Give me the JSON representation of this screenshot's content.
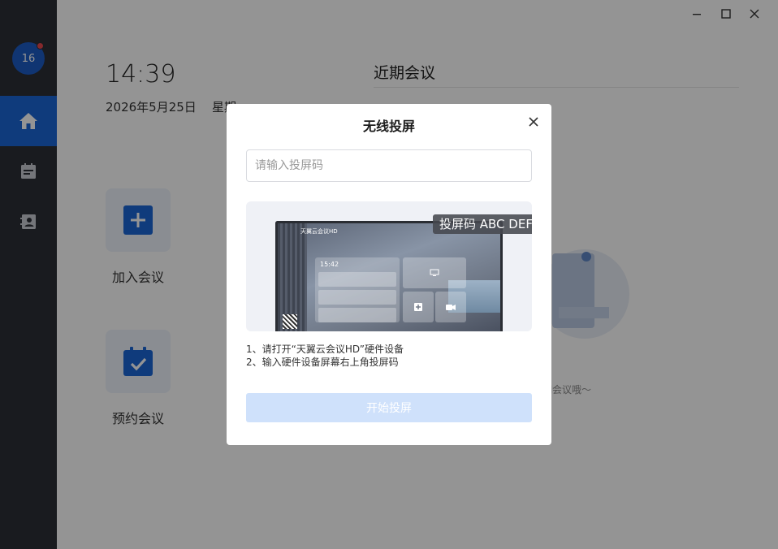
{
  "colors": {
    "sidebar_bg": "#2c2f36",
    "accent": "#1a66d6",
    "badge_dot": "#e5484d",
    "start_button_disabled": "#cfe1fb"
  },
  "sidebar": {
    "avatar_text": "16",
    "items": [
      {
        "name": "home",
        "icon": "home-icon",
        "active": true
      },
      {
        "name": "schedule",
        "icon": "calendar-icon",
        "active": false
      },
      {
        "name": "contacts",
        "icon": "contacts-icon",
        "active": false
      }
    ]
  },
  "window_controls": {
    "minimize": "minimize-icon",
    "maximize": "maximize-icon",
    "close": "close-icon"
  },
  "home": {
    "time": "14:39",
    "date": "2026年5月25日",
    "weekday": "星期",
    "recent_title": "近期会议",
    "join_label": "加入会议",
    "book_label": "预约会议",
    "empty_text": "期会议哦～"
  },
  "dialog": {
    "title": "无线投屏",
    "input_placeholder": "请输入投屏码",
    "input_value": "",
    "code_badge": "投屏码 ABC DEF",
    "preview": {
      "brand": "天翼云会议HD",
      "time": "15:42"
    },
    "instructions": [
      "1、请打开“天翼云会议HD”硬件设备",
      "2、输入硬件设备屏幕右上角投屏码"
    ],
    "start_label": "开始投屏"
  }
}
